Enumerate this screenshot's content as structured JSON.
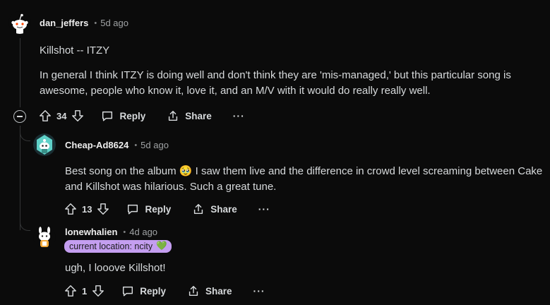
{
  "comments": [
    {
      "username": "dan_jeffers",
      "separator": "•",
      "timestamp": "5d ago",
      "paragraphs": [
        "Killshot -- ITZY",
        "In general I think ITZY is doing well and don't think they are 'mis-managed,' but this particular song is awesome, people who know it, love it, and an M/V with it would do really really well."
      ],
      "votes": "34",
      "reply_label": "Reply",
      "share_label": "Share",
      "more_label": "···"
    },
    {
      "username": "Cheap-Ad8624",
      "separator": "•",
      "timestamp": "5d ago",
      "paragraphs": [
        "Best song on the album 🥹 I saw them live and the difference in crowd level screaming between Cake and Killshot was hilarious. Such a great tune."
      ],
      "votes": "13",
      "reply_label": "Reply",
      "share_label": "Share",
      "more_label": "···"
    },
    {
      "username": "lonewhalien",
      "separator": "•",
      "timestamp": "4d ago",
      "flair_text": "current location: ncity",
      "flair_emoji": "💚",
      "paragraphs": [
        "ugh, I looove Killshot!"
      ],
      "votes": "1",
      "reply_label": "Reply",
      "share_label": "Share",
      "more_label": "···"
    }
  ],
  "colors": {
    "background": "#0b0b0b",
    "text": "#d7dadc",
    "muted": "#818384",
    "flair_bg": "#c49ef0",
    "thread_line": "#343536"
  }
}
